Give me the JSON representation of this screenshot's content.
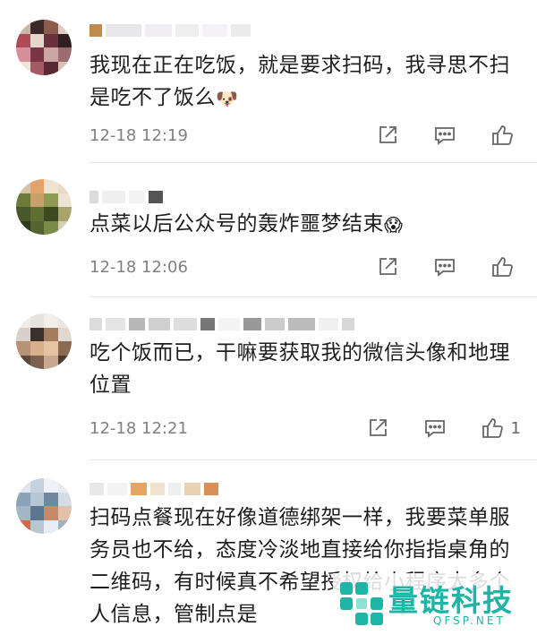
{
  "comments": [
    {
      "text": "我现在正在吃饭，就是要求扫码，我寻思不扫是吃不了饭么",
      "emoji": "🐶",
      "time": "12-18 12:19",
      "likes": ""
    },
    {
      "text": "点菜以后公众号的轰炸噩梦结束",
      "emoji": "😱",
      "time": "12-18 12:06",
      "likes": ""
    },
    {
      "text": "吃个饭而已，干嘛要获取我的微信头像和地理位置",
      "emoji": "",
      "time": "12-18 12:21",
      "likes": "1"
    },
    {
      "text": "扫码点餐现在好像道德绑架一样，我要菜单服务员也不给，态度冷淡地直接给你指指桌角的二维码，有时候真不希望授权给小程序太多个人信息，管制点是",
      "emoji": "",
      "time": "",
      "likes": ""
    }
  ],
  "watermark": {
    "title": "量链科技",
    "domain": "QFSP.NET",
    "color": "#1fb5a6"
  },
  "icons": {
    "share": "share-icon",
    "comment": "comment-icon",
    "like": "thumbs-up-icon"
  }
}
